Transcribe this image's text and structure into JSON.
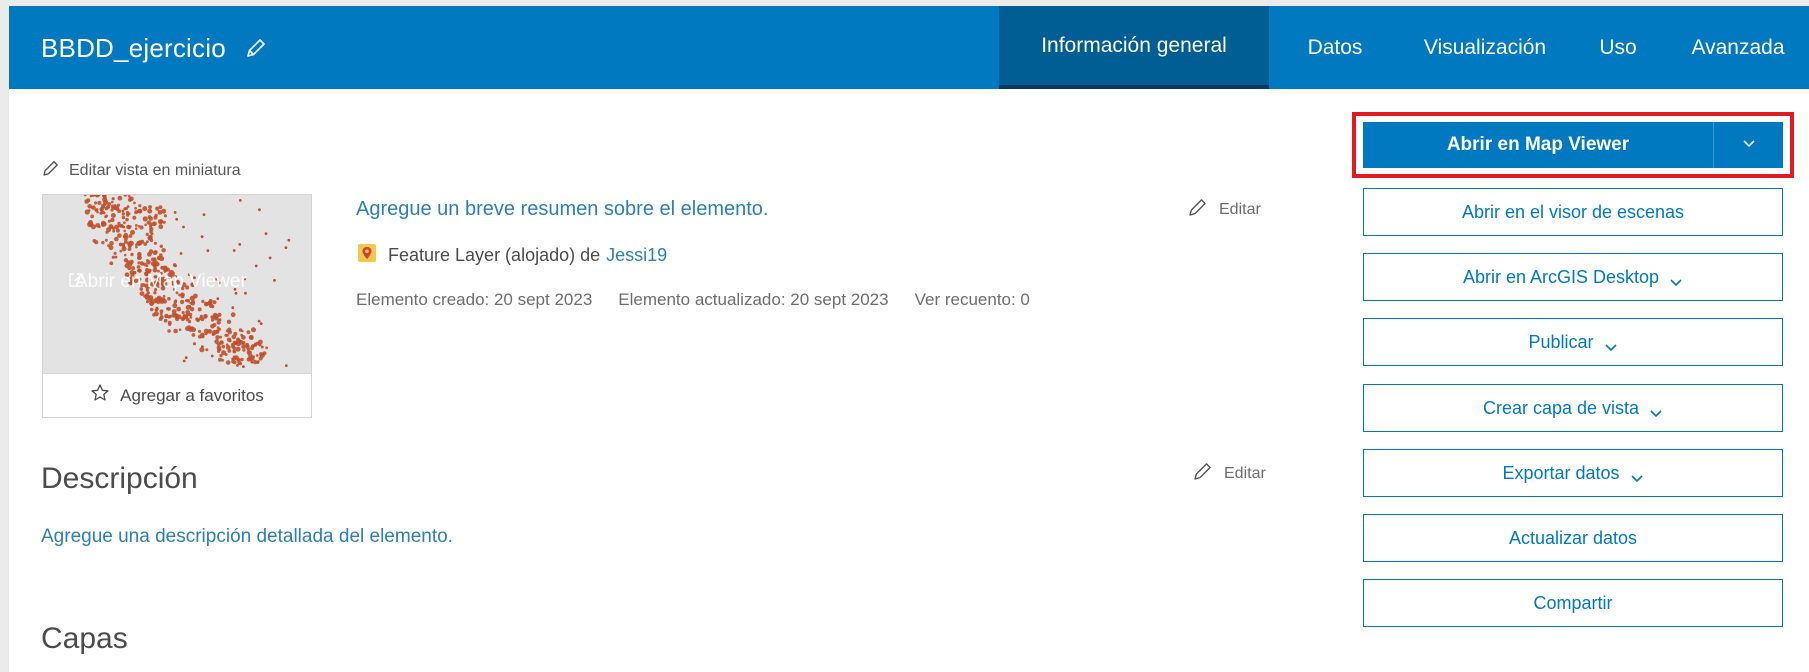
{
  "header": {
    "title": "BBDD_ejercicio",
    "tabs": [
      {
        "label": "Información general",
        "active": true
      },
      {
        "label": "Datos"
      },
      {
        "label": "Visualización"
      },
      {
        "label": "Uso"
      },
      {
        "label": "Avanzada"
      }
    ]
  },
  "thumbnail": {
    "edit_label": "Editar vista en miniatura",
    "overlay_label": "Abrir en Map Viewer",
    "favorite_label": "Agregar a favoritos"
  },
  "summary": {
    "text": "Agregue un breve resumen sobre el elemento.",
    "edit_label": "Editar",
    "type_text": "Feature Layer (alojado) de",
    "owner": "Jessi19",
    "created": "Elemento creado: 20 sept 2023",
    "updated": "Elemento actualizado: 20 sept 2023",
    "views": "Ver recuento: 0"
  },
  "description": {
    "heading": "Descripción",
    "edit_label": "Editar",
    "text": "Agregue una descripción detallada del elemento."
  },
  "layers": {
    "heading": "Capas"
  },
  "actions": {
    "primary": "Abrir en Map Viewer",
    "buttons": [
      {
        "label": "Abrir en el visor de escenas",
        "dropdown": false
      },
      {
        "label": "Abrir en ArcGIS Desktop",
        "dropdown": true
      },
      {
        "label": "Publicar",
        "dropdown": true
      },
      {
        "label": "Crear capa de vista",
        "dropdown": true
      },
      {
        "label": "Exportar datos",
        "dropdown": true
      },
      {
        "label": "Actualizar datos",
        "dropdown": false
      },
      {
        "label": "Compartir",
        "dropdown": false
      }
    ]
  },
  "colors": {
    "header_bg": "#0079c1",
    "active_tab_bg": "#005e95",
    "link": "#2d7fb8",
    "highlight_border": "#e11a22",
    "map_points": "#c0502a"
  },
  "icons": {
    "title_edit": "pencil-icon",
    "layer_type": "feature-layer-icon",
    "favorite": "star-icon",
    "dropdown": "chevron-down-icon",
    "overlay": "external-link-icon"
  }
}
